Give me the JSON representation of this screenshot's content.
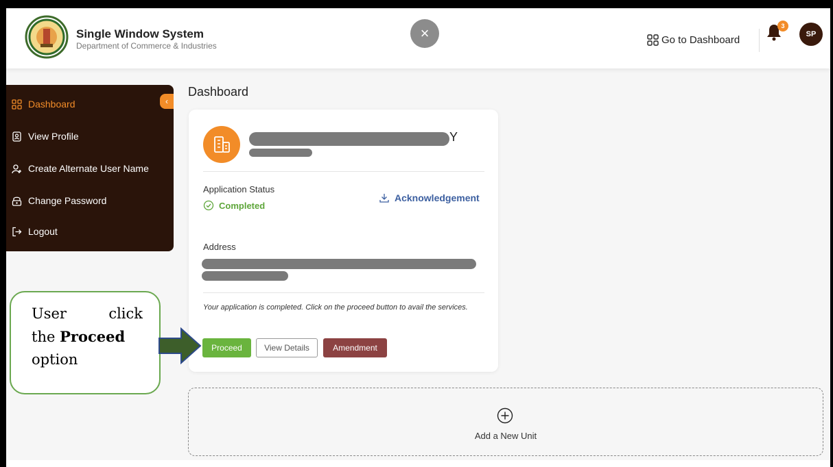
{
  "header": {
    "title": "Single Window System",
    "subtitle": "Department of Commerce & Industries",
    "close_label": "×",
    "dashboard_link": "Go to Dashboard",
    "notification_count": "3",
    "avatar_initials": "SP"
  },
  "sidebar": {
    "items": [
      {
        "label": "Dashboard",
        "icon": "grid-icon",
        "active": true
      },
      {
        "label": "View Profile",
        "icon": "profile-icon"
      },
      {
        "label": "Create Alternate User Name",
        "icon": "add-user-icon"
      },
      {
        "label": "Change Password",
        "icon": "key-icon"
      },
      {
        "label": "Logout",
        "icon": "logout-icon"
      }
    ]
  },
  "main": {
    "title": "Dashboard",
    "card": {
      "unit_name_visible": "Y",
      "application_status_label": "Application Status",
      "status_value": "Completed",
      "acknowledgement_label": "Acknowledgement",
      "address_label": "Address",
      "note": "Your application is completed. Click on the proceed button to avail the services.",
      "buttons": {
        "proceed": "Proceed",
        "view_details": "View Details",
        "amendment": "Amendment"
      }
    },
    "add_unit_label": "Add a New Unit"
  },
  "callout": {
    "word1": "User",
    "word2": "click",
    "line2_prefix": "the",
    "line2_bold": "Proceed",
    "line3": "option"
  },
  "colors": {
    "accent_orange": "#f28c28",
    "sidebar_bg": "#2a140a",
    "proceed_green": "#6ab43e",
    "amend_red": "#8c4242",
    "link_blue": "#3c5fa0"
  }
}
